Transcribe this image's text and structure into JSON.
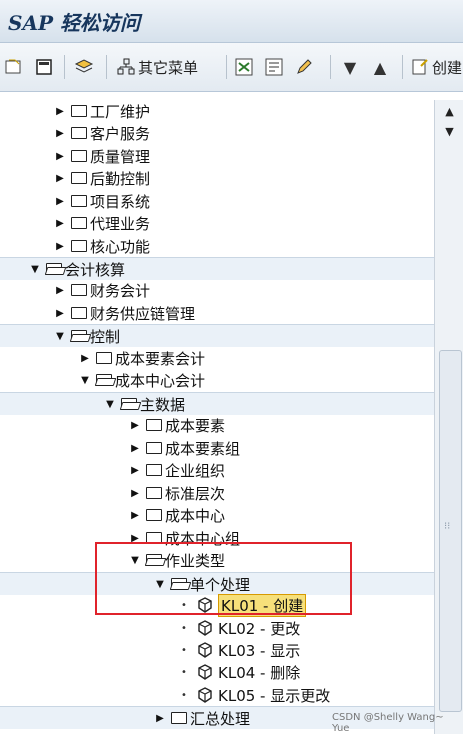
{
  "window": {
    "title": "SAP 轻松访问"
  },
  "toolbar": {
    "other_menu_label": "其它菜单",
    "create_label": "创建",
    "icons": [
      "favorites-add-icon",
      "favorites-edit-icon",
      "folder-move-icon",
      "menu-icon",
      "sap-menu-icon",
      "tcode-icon",
      "pencil-icon",
      "arrow-down-icon",
      "arrow-up-icon",
      "create-icon"
    ]
  },
  "tree": {
    "rows": [
      {
        "label": "工厂维护",
        "type": "folder",
        "state": "collapsed"
      },
      {
        "label": "客户服务",
        "type": "folder",
        "state": "collapsed"
      },
      {
        "label": "质量管理",
        "type": "folder",
        "state": "collapsed"
      },
      {
        "label": "后勤控制",
        "type": "folder",
        "state": "collapsed"
      },
      {
        "label": "项目系统",
        "type": "folder",
        "state": "collapsed"
      },
      {
        "label": "代理业务",
        "type": "folder",
        "state": "collapsed"
      },
      {
        "label": "核心功能",
        "type": "folder",
        "state": "collapsed"
      },
      {
        "label": "会计核算",
        "type": "folder",
        "state": "expanded"
      },
      {
        "label": "财务会计",
        "type": "folder",
        "state": "collapsed"
      },
      {
        "label": "财务供应链管理",
        "type": "folder",
        "state": "collapsed"
      },
      {
        "label": "控制",
        "type": "folder",
        "state": "expanded"
      },
      {
        "label": "成本要素会计",
        "type": "folder",
        "state": "collapsed"
      },
      {
        "label": "成本中心会计",
        "type": "folder",
        "state": "expanded"
      },
      {
        "label": "主数据",
        "type": "folder",
        "state": "expanded"
      },
      {
        "label": "成本要素",
        "type": "folder",
        "state": "collapsed"
      },
      {
        "label": "成本要素组",
        "type": "folder",
        "state": "collapsed"
      },
      {
        "label": "企业组织",
        "type": "folder",
        "state": "collapsed"
      },
      {
        "label": "标准层次",
        "type": "folder",
        "state": "collapsed"
      },
      {
        "label": "成本中心",
        "type": "folder",
        "state": "collapsed"
      },
      {
        "label": "成本中心组",
        "type": "folder",
        "state": "collapsed"
      },
      {
        "label": "作业类型",
        "type": "folder",
        "state": "expanded"
      },
      {
        "label": "单个处理",
        "type": "folder",
        "state": "expanded"
      },
      {
        "label": "KL01 - 创建",
        "type": "transaction",
        "selected": true
      },
      {
        "label": "KL02 - 更改",
        "type": "transaction"
      },
      {
        "label": "KL03 - 显示",
        "type": "transaction"
      },
      {
        "label": "KL04 - 删除",
        "type": "transaction"
      },
      {
        "label": "KL05 - 显示更改",
        "type": "transaction"
      },
      {
        "label": "汇总处理",
        "type": "folder",
        "state": "collapsed"
      }
    ]
  },
  "watermark": "CSDN @Shelly Wang~ Yue",
  "colors": {
    "highlight": "#e0232b",
    "selection": "#f6e07a",
    "title": "#17365d"
  }
}
